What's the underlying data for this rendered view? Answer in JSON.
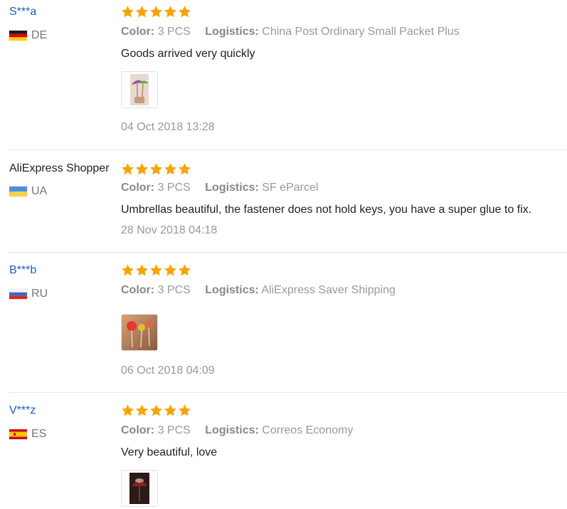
{
  "labels": {
    "color": "Color:",
    "logistics": "Logistics:"
  },
  "colors": {
    "star": "#f7a400",
    "link": "#1a5fb4"
  },
  "reviews": [
    {
      "user": "S***a",
      "country": "DE",
      "flag": "de-flag",
      "rating": 5,
      "color": "3 PCS",
      "logistics": "China Post Ordinary Small Packet Plus",
      "text": "Goods arrived very quickly",
      "photo": "umbrella-photo",
      "date": "04 Oct 2018 13:28"
    },
    {
      "user": "AliExpress Shopper",
      "country": "UA",
      "flag": "ua-flag",
      "rating": 5,
      "color": "3 PCS",
      "logistics": "SF eParcel",
      "text": "Umbrellas beautiful, the fastener does not hold keys, you have a super glue to fix.",
      "date": "28 Nov 2018 04:18"
    },
    {
      "user": "B***b",
      "country": "RU",
      "flag": "ru-flag",
      "rating": 5,
      "color": "3 PCS",
      "logistics": "AliExpress Saver Shipping",
      "text": "",
      "photo": "umbrella-photo",
      "date": "06 Oct 2018 04:09"
    },
    {
      "user": "V***z",
      "country": "ES",
      "flag": "es-flag",
      "rating": 5,
      "color": "3 PCS",
      "logistics": "Correos Economy",
      "text": "Very beautiful, love",
      "photo": "umbrella-photo"
    }
  ]
}
